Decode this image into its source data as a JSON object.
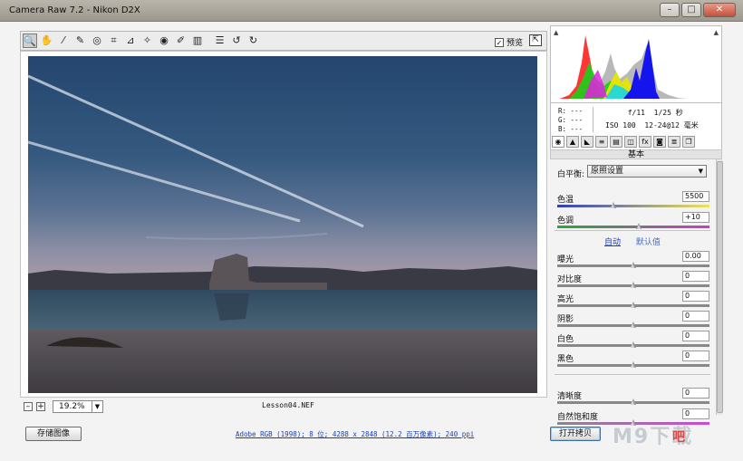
{
  "window": {
    "title": "Camera Raw 7.2 -  Nikon D2X",
    "minimize": "–",
    "maximize": "□",
    "close": "✕"
  },
  "toolbar": {
    "tools": [
      {
        "name": "zoom-tool",
        "glyph": "🔍",
        "active": true
      },
      {
        "name": "hand-tool",
        "glyph": "✋"
      },
      {
        "name": "white-balance-tool",
        "glyph": "⁄"
      },
      {
        "name": "color-sampler-tool",
        "glyph": "✎"
      },
      {
        "name": "targeted-adjustment-tool",
        "glyph": "◎"
      },
      {
        "name": "crop-tool",
        "glyph": "⌗"
      },
      {
        "name": "straighten-tool",
        "glyph": "⊿"
      },
      {
        "name": "spot-removal-tool",
        "glyph": "✧"
      },
      {
        "name": "red-eye-tool",
        "glyph": "◉"
      },
      {
        "name": "adjustment-brush-tool",
        "glyph": "✐"
      },
      {
        "name": "graduated-filter-tool",
        "glyph": "▥"
      },
      {
        "name": "preferences-tool",
        "glyph": "☰"
      },
      {
        "name": "rotate-left-tool",
        "glyph": "↺"
      },
      {
        "name": "rotate-right-tool",
        "glyph": "↻"
      }
    ],
    "preview_label": "预览",
    "preview_checked": "✓",
    "fullscreen_glyph": "⇱"
  },
  "status": {
    "zoom_out": "–",
    "zoom_in": "+",
    "zoom_value": "19.2%",
    "zoom_caret": "▼",
    "filename": "Lesson04.NEF"
  },
  "bottom": {
    "save_label": "存储图像",
    "workflow_link": "Adobe RGB (1998); 8 位; 4288 x 2848 (12.2 百万像素); 240 ppi",
    "open_label": "打开拷贝",
    "watermark": "M9下载",
    "watermark2": "吧"
  },
  "histogram": {
    "clip_left": "▲",
    "clip_right": "▲"
  },
  "info": {
    "r": "R:  ---",
    "g": "G:  ---",
    "b": "B:  ---",
    "aperture": "f/11",
    "shutter": "1/25 秒",
    "iso": "ISO 100",
    "lens": "12-24@12 毫米"
  },
  "panel_tabs": [
    "◉",
    "▲",
    "◣",
    "≡",
    "▤",
    "◫",
    "fx",
    "◙",
    "≣",
    "❐"
  ],
  "panel": {
    "title": "基本",
    "wb_label": "白平衡:",
    "wb_value": "原照设置",
    "wb_caret": "▼",
    "auto_label": "自动",
    "default_label": "默认值",
    "sliders": [
      {
        "key": "temp",
        "label": "色温",
        "value": "5500",
        "pos": 0.37,
        "track": "temp"
      },
      {
        "key": "tint",
        "label": "色调",
        "value": "+10",
        "pos": 0.54,
        "track": "tint"
      },
      {
        "key": "exposure",
        "label": "曝光",
        "value": "0.00",
        "pos": 0.5
      },
      {
        "key": "contrast",
        "label": "对比度",
        "value": "0",
        "pos": 0.5
      },
      {
        "key": "highlights",
        "label": "高光",
        "value": "0",
        "pos": 0.5
      },
      {
        "key": "shadows",
        "label": "阴影",
        "value": "0",
        "pos": 0.5
      },
      {
        "key": "whites",
        "label": "白色",
        "value": "0",
        "pos": 0.5
      },
      {
        "key": "blacks",
        "label": "黑色",
        "value": "0",
        "pos": 0.5
      },
      {
        "key": "clarity",
        "label": "清晰度",
        "value": "0",
        "pos": 0.5
      },
      {
        "key": "vibrance",
        "label": "自然饱和度",
        "value": "0",
        "pos": 0.5,
        "track": "vib"
      }
    ]
  }
}
